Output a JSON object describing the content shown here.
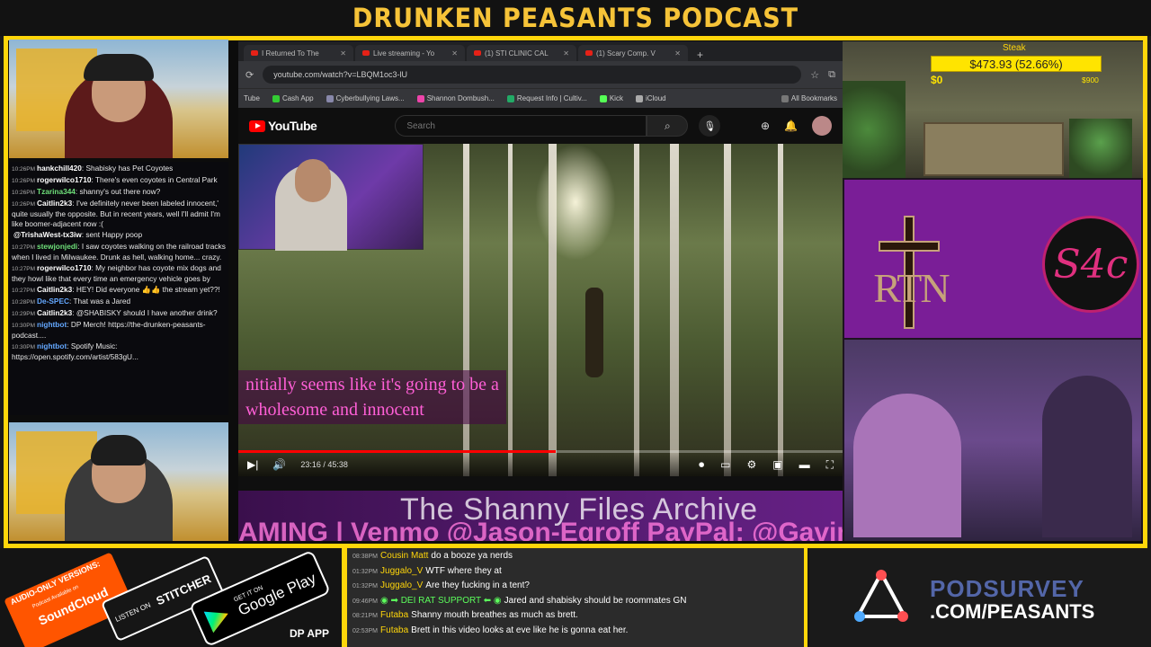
{
  "banner": {
    "title": "DRUNKEN PEASANTS PODCAST"
  },
  "colors": {
    "accent": "#ffd60a",
    "youtube_red": "#ff0000",
    "ticker": "#5c1f7a"
  },
  "left_chat": [
    {
      "time": "10:26PM",
      "user": "hankchill420",
      "text": "Shabisky has Pet Coyotes",
      "color": "white"
    },
    {
      "time": "10:26PM",
      "user": "rogerwilco1710",
      "text": "There's even coyotes in Central Park",
      "color": "white"
    },
    {
      "time": "10:26PM",
      "user": "Tzarina344",
      "text": "shanny's out there now?",
      "color": "green"
    },
    {
      "time": "10:26PM",
      "user": "Caitlin2k3",
      "text": "I've definitely never been labeled innocent,' quite usually the opposite. But in recent years, well I'll admit I'm like boomer-adjacent now :(",
      "color": "white"
    },
    {
      "time": "",
      "user": "@TrishaWest-tx3iw",
      "text": "sent Happy poop",
      "color": "white"
    },
    {
      "time": "10:27PM",
      "user": "stewjonjedi",
      "text": "I saw coyotes walking on the railroad tracks when I lived in Milwaukee. Drunk as hell, walking home... crazy.",
      "color": "green"
    },
    {
      "time": "10:27PM",
      "user": "rogerwilco1710",
      "text": "My neighbor has coyote mix dogs and they howl like that every time an emergency vehicle goes by",
      "color": "white"
    },
    {
      "time": "10:27PM",
      "user": "Caitlin2k3",
      "text": "HEY! Did everyone 👍👍 the stream yet??!",
      "color": "white"
    },
    {
      "time": "10:28PM",
      "user": "De-SPEC",
      "text": "That was a Jared",
      "color": "blue"
    },
    {
      "time": "10:29PM",
      "user": "Caitlin2k3",
      "text": "@SHABISKY should I have another drink?",
      "color": "white"
    },
    {
      "time": "10:30PM",
      "user": "nightbot",
      "text": "DP Merch! https://the-drunken-peasants-podcast....",
      "color": "blue"
    },
    {
      "time": "10:30PM",
      "user": "nightbot",
      "text": "Spotify Music: https://open.spotify.com/artist/583gU...",
      "color": "blue"
    }
  ],
  "browser": {
    "tabs": [
      "I Returned To The",
      "Live streaming - Yo",
      "(1) STI CLINIC CAL",
      "(1) Scary Comp. V"
    ],
    "new_tab": "+",
    "url": "youtube.com/watch?v=LBQM1oc3-lU",
    "bookmarks": [
      "Tube",
      "Cash App",
      "Cyberbullying Laws...",
      "Shannon Dombush...",
      "Request Info | Cultiv...",
      "Kick",
      "iCloud",
      "All Bookmarks"
    ]
  },
  "youtube": {
    "logo_text": "YouTube",
    "search_placeholder": "Search",
    "subtitle_line1": "nitially seems like it's going to be a",
    "subtitle_line2": "wholesome and innocent",
    "time": "23:16 / 45:38"
  },
  "ticker": {
    "archive": "The Shanny Files Archive",
    "scroll": "AMING | Venmo @Jason-Egroff PayPal: @GavinK"
  },
  "goal": {
    "title": "Steak",
    "amount": "$473.93 (52.66%)",
    "min": "$0",
    "max": "$900",
    "progress": 52.66
  },
  "logos": {
    "rtn": "RTN",
    "s4c": "S4c"
  },
  "audio": {
    "label": "AUDIO-ONLY VERSIONS:",
    "soundcloud_small": "Podcast Available on",
    "soundcloud": "SoundCloud",
    "stitcher_small": "LISTEN ON",
    "stitcher": "STITCHER",
    "gp_small": "GET IT ON",
    "gp": "Google Play",
    "dp_app": "DP APP"
  },
  "bottom_chat": [
    {
      "time": "08:38PM",
      "user": "Cousin Matt",
      "text": "do a booze ya nerds",
      "color": "yellow"
    },
    {
      "time": "01:32PM",
      "user": "Juggalo_V",
      "text": "WTF where they at",
      "color": "yellow"
    },
    {
      "time": "01:32PM",
      "user": "Juggalo_V",
      "text": "Are they fucking in a tent?",
      "color": "yellow"
    },
    {
      "time": "09:46PM",
      "user": "◉ ➡ DEI RAT SUPPORT ⬅ ◉",
      "text": "Jared and shabisky should be roommates GN",
      "color": "green"
    },
    {
      "time": "08:21PM",
      "user": "Futaba",
      "text": "Shanny mouth breathes as much as brett.",
      "color": "yellow"
    },
    {
      "time": "02:53PM",
      "user": "Futaba",
      "text": "Brett in this video looks at eve like he is gonna eat her.",
      "color": "yellow"
    }
  ],
  "survey": {
    "line1": "PODSURVEY",
    "line2": ".COM/PEASANTS"
  }
}
